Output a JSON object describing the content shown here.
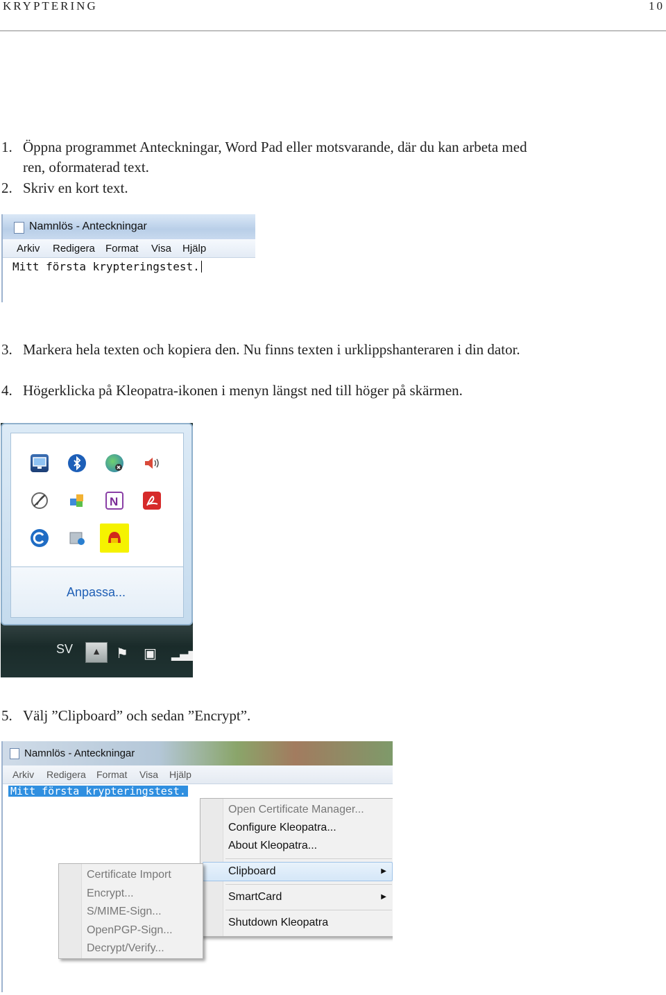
{
  "header": {
    "title": "KRYPTERING",
    "page": "10"
  },
  "steps": [
    {
      "num": "1.",
      "text": "Öppna programmet Anteckningar, Word Pad eller motsvarande, där du kan arbeta med ren, oformaterad text."
    },
    {
      "num": "2.",
      "text": "Skriv en kort text."
    },
    {
      "num": "3.",
      "text": "Markera hela texten och kopiera den. Nu finns texten i urklippshanteraren i din dator."
    },
    {
      "num": "4.",
      "text": "Högerklicka på Kleopatra-ikonen i menyn längst ned till höger på skärmen."
    },
    {
      "num": "5.",
      "text": "Välj ”Clipboard” och sedan ”Encrypt”."
    }
  ],
  "notepad": {
    "title": "Namnlös - Anteckningar",
    "menu": [
      "Arkiv",
      "Redigera",
      "Format",
      "Visa",
      "Hjälp"
    ],
    "content": "Mitt första krypteringstest."
  },
  "tray": {
    "customize_label": "Anpassa...",
    "language": "SV",
    "icons": [
      "monitor-icon",
      "bluetooth-icon",
      "network-globe-icon",
      "speaker-icon",
      "feather-icon",
      "puzzle-icon",
      "onenote-icon",
      "acrobat-icon",
      "refresh-circle-icon",
      "safe-icon",
      "kleopatra-icon"
    ],
    "highlight_color": "#f5f200"
  },
  "context_menu": {
    "items": [
      "Open Certificate Manager...",
      "Configure Kleopatra...",
      "About Kleopatra...",
      "Clipboard",
      "SmartCard",
      "Shutdown Kleopatra"
    ]
  },
  "clipboard_submenu": {
    "items": [
      "Certificate Import",
      "Encrypt...",
      "S/MIME-Sign...",
      "OpenPGP-Sign...",
      "Decrypt/Verify..."
    ]
  }
}
